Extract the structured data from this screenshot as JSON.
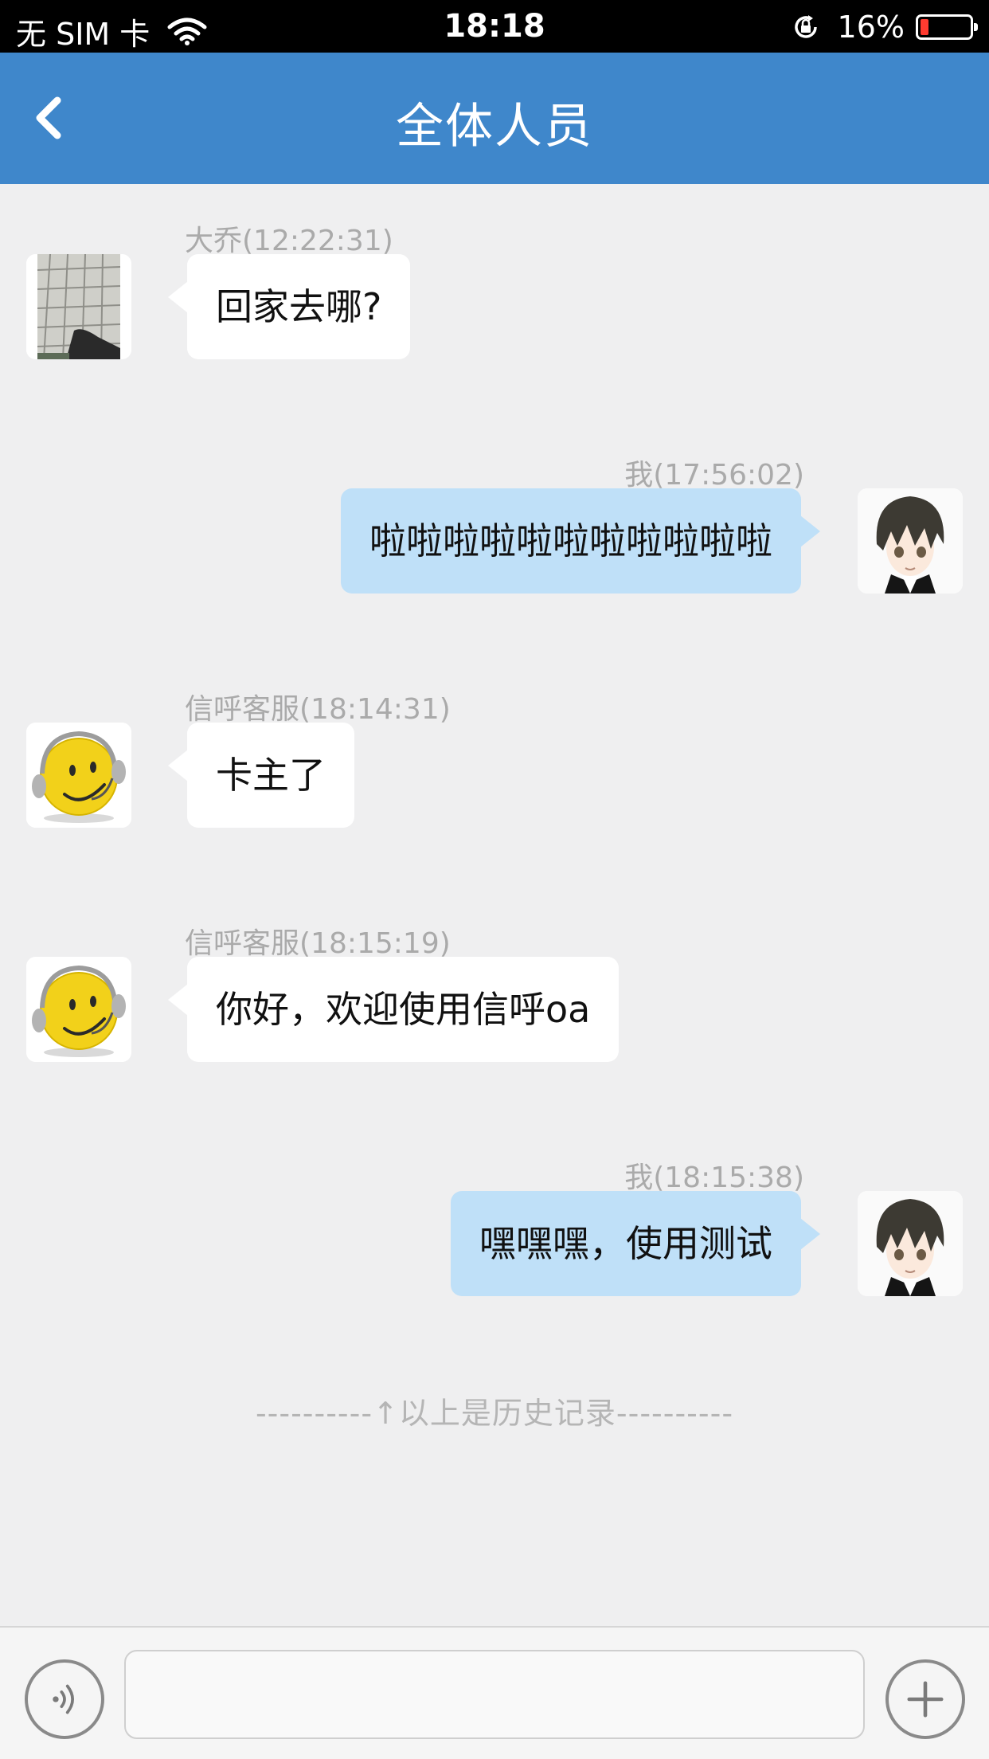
{
  "status_bar": {
    "carrier": "无 SIM 卡",
    "time": "18:18",
    "battery_percent": "16%",
    "battery_level": 0.16,
    "battery_color": "#ff3b30"
  },
  "header": {
    "title": "全体人员",
    "back_icon": "chevron-left-icon",
    "background": "#3f87cb"
  },
  "messages": [
    {
      "direction": "in",
      "meta": "大乔(12:22:31)",
      "text": "回家去哪?",
      "avatar": "photo-tiles-avatar"
    },
    {
      "direction": "out",
      "meta": "我(17:56:02)",
      "text": "啦啦啦啦啦啦啦啦啦啦啦",
      "avatar": "anime-boy-avatar"
    },
    {
      "direction": "in",
      "meta": "信呼客服(18:14:31)",
      "text": "卡主了",
      "avatar": "smiley-headset-avatar"
    },
    {
      "direction": "in",
      "meta": "信呼客服(18:15:19)",
      "text": "你好，欢迎使用信呼oa",
      "avatar": "smiley-headset-avatar"
    },
    {
      "direction": "out",
      "meta": "我(18:15:38)",
      "text": "嘿嘿嘿，使用测试",
      "avatar": "anime-boy-avatar"
    }
  ],
  "history_divider": "----------↑以上是历史记录----------",
  "input_bar": {
    "voice_icon": "voice-icon",
    "input_value": "",
    "plus_icon": "plus-icon"
  },
  "colors": {
    "outgoing_bubble": "#bfe0f8",
    "incoming_bubble": "#ffffff",
    "chat_background": "#efeff0"
  }
}
